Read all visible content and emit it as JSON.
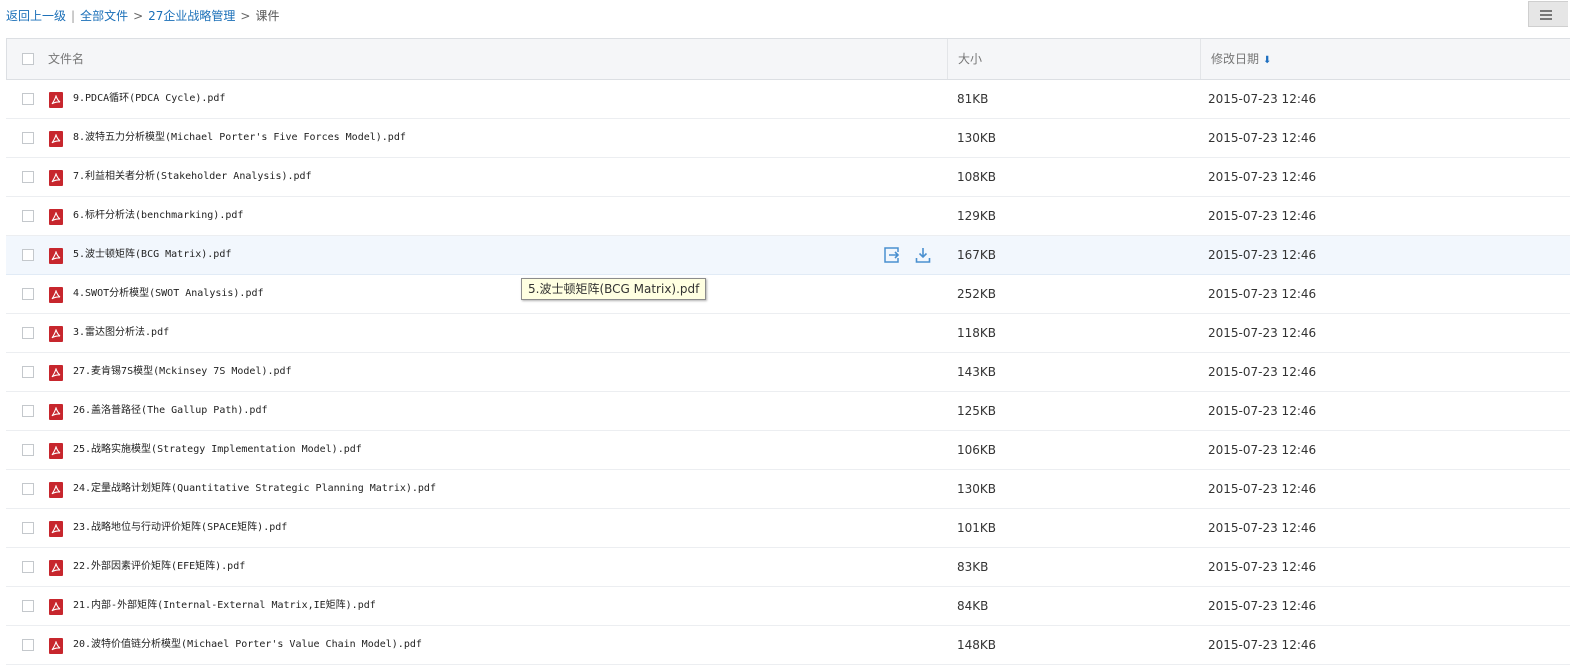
{
  "breadcrumb": {
    "back": "返回上一级",
    "divider": "|",
    "items": [
      "全部文件",
      "27企业战略管理"
    ],
    "current": "课件",
    "separator": ">"
  },
  "view_toggle_icon": "list-view-icon",
  "table": {
    "headers": {
      "name": "文件名",
      "size": "大小",
      "date": "修改日期"
    },
    "sort_icon": "sort-down-arrow-icon",
    "file_icon": "pdf-file-icon",
    "hover_actions": [
      "share-icon",
      "download-icon"
    ],
    "rows": [
      {
        "name": "9.PDCA循环(PDCA Cycle).pdf",
        "size": "81KB",
        "date": "2015-07-23 12:46"
      },
      {
        "name": "8.波特五力分析模型(Michael Porter's Five Forces Model).pdf",
        "size": "130KB",
        "date": "2015-07-23 12:46"
      },
      {
        "name": "7.利益相关者分析(Stakeholder Analysis).pdf",
        "size": "108KB",
        "date": "2015-07-23 12:46"
      },
      {
        "name": "6.标杆分析法(benchmarking).pdf",
        "size": "129KB",
        "date": "2015-07-23 12:46"
      },
      {
        "name": "5.波士顿矩阵(BCG Matrix).pdf",
        "size": "167KB",
        "date": "2015-07-23 12:46"
      },
      {
        "name": "4.SWOT分析模型(SWOT Analysis).pdf",
        "size": "252KB",
        "date": "2015-07-23 12:46"
      },
      {
        "name": "3.雷达图分析法.pdf",
        "size": "118KB",
        "date": "2015-07-23 12:46"
      },
      {
        "name": "27.麦肯锡7S模型(Mckinsey 7S Model).pdf",
        "size": "143KB",
        "date": "2015-07-23 12:46"
      },
      {
        "name": "26.盖洛普路径(The Gallup Path).pdf",
        "size": "125KB",
        "date": "2015-07-23 12:46"
      },
      {
        "name": "25.战略实施模型(Strategy Implementation Model).pdf",
        "size": "106KB",
        "date": "2015-07-23 12:46"
      },
      {
        "name": "24.定量战略计划矩阵(Quantitative Strategic Planning Matrix).pdf",
        "size": "130KB",
        "date": "2015-07-23 12:46"
      },
      {
        "name": "23.战略地位与行动评价矩阵(SPACE矩阵).pdf",
        "size": "101KB",
        "date": "2015-07-23 12:46"
      },
      {
        "name": "22.外部因素评价矩阵(EFE矩阵).pdf",
        "size": "83KB",
        "date": "2015-07-23 12:46"
      },
      {
        "name": "21.内部-外部矩阵(Internal-External Matrix,IE矩阵).pdf",
        "size": "84KB",
        "date": "2015-07-23 12:46"
      },
      {
        "name": "20.波特价值链分析模型(Michael Porter's Value Chain Model).pdf",
        "size": "148KB",
        "date": "2015-07-23 12:46"
      }
    ]
  },
  "hover_row_index": 4,
  "tooltip": {
    "text": "5.波士顿矩阵(BCG Matrix).pdf"
  },
  "colors": {
    "link": "#1a6fb8",
    "pdf": "#c7262d",
    "action": "#4a90d0",
    "hover_row": "#f2f7fd"
  }
}
